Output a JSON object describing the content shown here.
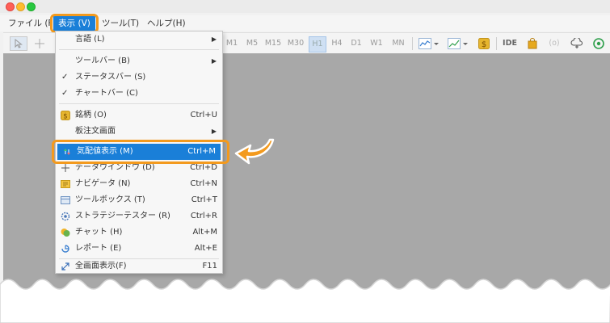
{
  "menubar": {
    "items": [
      {
        "label": "ファイル (F)"
      },
      {
        "label": "表示 (V)"
      },
      {
        "label": "ツール(T)"
      },
      {
        "label": "ヘルプ(H)"
      }
    ]
  },
  "toolbar": {
    "timeframes": [
      "M1",
      "M5",
      "M15",
      "M30",
      "H1",
      "H4",
      "D1",
      "W1",
      "MN"
    ],
    "active_timeframe": "H1",
    "ide_label": "IDE",
    "signal_label": "(o)"
  },
  "view_menu": {
    "items": [
      {
        "label": "言語 (L)",
        "shortcut": "",
        "submenu": true,
        "checked": false,
        "icon": "none"
      },
      {
        "label": "ツールバー (B)",
        "shortcut": "",
        "submenu": true,
        "checked": false,
        "icon": "none"
      },
      {
        "label": "ステータスバー (S)",
        "shortcut": "",
        "submenu": false,
        "checked": true,
        "icon": "none"
      },
      {
        "label": "チャートバー (C)",
        "shortcut": "",
        "submenu": false,
        "checked": true,
        "icon": "none"
      },
      {
        "label": "銘柄 (O)",
        "shortcut": "Ctrl+U",
        "submenu": false,
        "checked": false,
        "icon": "symbols-icon"
      },
      {
        "label": "板注文画面",
        "shortcut": "",
        "submenu": true,
        "checked": false,
        "icon": "none"
      },
      {
        "label": "気配値表示 (M)",
        "shortcut": "Ctrl+M",
        "submenu": false,
        "checked": false,
        "icon": "market-watch-icon",
        "selected": true
      },
      {
        "label": "データウインドウ (D)",
        "shortcut": "Ctrl+D",
        "submenu": false,
        "checked": false,
        "icon": "crosshair-icon"
      },
      {
        "label": "ナビゲータ (N)",
        "shortcut": "Ctrl+N",
        "submenu": false,
        "checked": false,
        "icon": "navigator-icon"
      },
      {
        "label": "ツールボックス (T)",
        "shortcut": "Ctrl+T",
        "submenu": false,
        "checked": false,
        "icon": "toolbox-icon"
      },
      {
        "label": "ストラテジーテスター (R)",
        "shortcut": "Ctrl+R",
        "submenu": false,
        "checked": false,
        "icon": "strategy-tester-icon"
      },
      {
        "label": "チャット (H)",
        "shortcut": "Alt+M",
        "submenu": false,
        "checked": false,
        "icon": "chat-icon"
      },
      {
        "label": "レポート (E)",
        "shortcut": "Alt+E",
        "submenu": false,
        "checked": false,
        "icon": "report-icon"
      },
      {
        "label": "全画面表示(F)",
        "shortcut": "F11",
        "submenu": false,
        "checked": false,
        "icon": "fullscreen-icon"
      }
    ]
  },
  "colors": {
    "accent": "#1a7fd8",
    "highlight": "#f39a1e",
    "workspace": "#a8a8a8"
  }
}
